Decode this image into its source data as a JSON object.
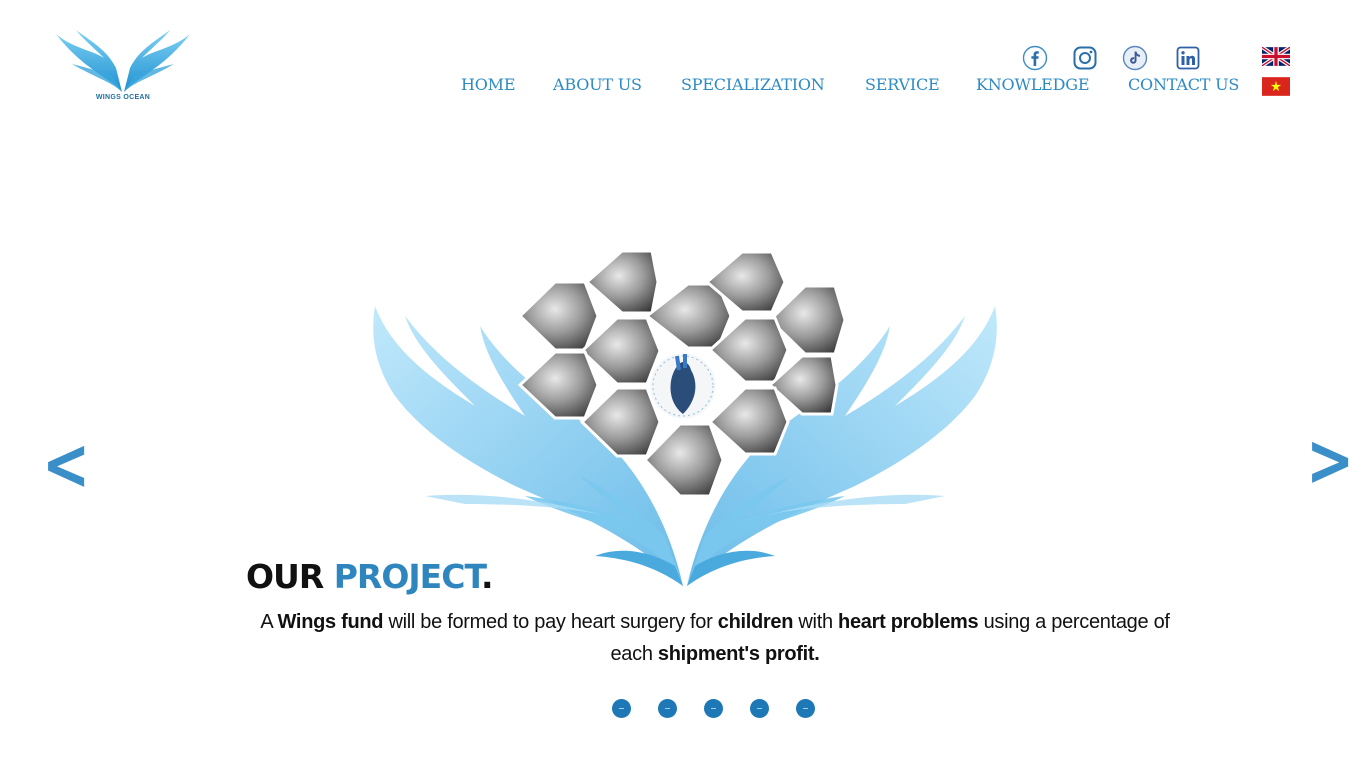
{
  "brand": {
    "name": "WINGS OCEAN",
    "accent": "#2d8bc4"
  },
  "social": [
    {
      "name": "facebook-icon"
    },
    {
      "name": "instagram-icon"
    },
    {
      "name": "tiktok-icon"
    },
    {
      "name": "linkedin-icon"
    }
  ],
  "languages": [
    {
      "name": "english-flag"
    },
    {
      "name": "vietnamese-flag"
    }
  ],
  "nav": {
    "home": "HOME",
    "about": "ABOUT US",
    "specialization": "SPECIALIZATION",
    "service": "SERVICE",
    "knowledge": "KNOWLEDGE",
    "contact": "CONTACT US"
  },
  "slider": {
    "prev": "<",
    "next": ">",
    "title_part1": "OUR ",
    "title_part2": "PROJECT",
    "title_part3": ".",
    "desc": {
      "t1": "A ",
      "b1": "Wings fund",
      "t2": " will be formed to pay heart surgery for ",
      "b2": "children",
      "t3": " with ",
      "b3": "heart problems",
      "t4": " using a percentage of each ",
      "b4": "shipment's profit."
    },
    "dots_count": 5,
    "active_dot": 1
  }
}
